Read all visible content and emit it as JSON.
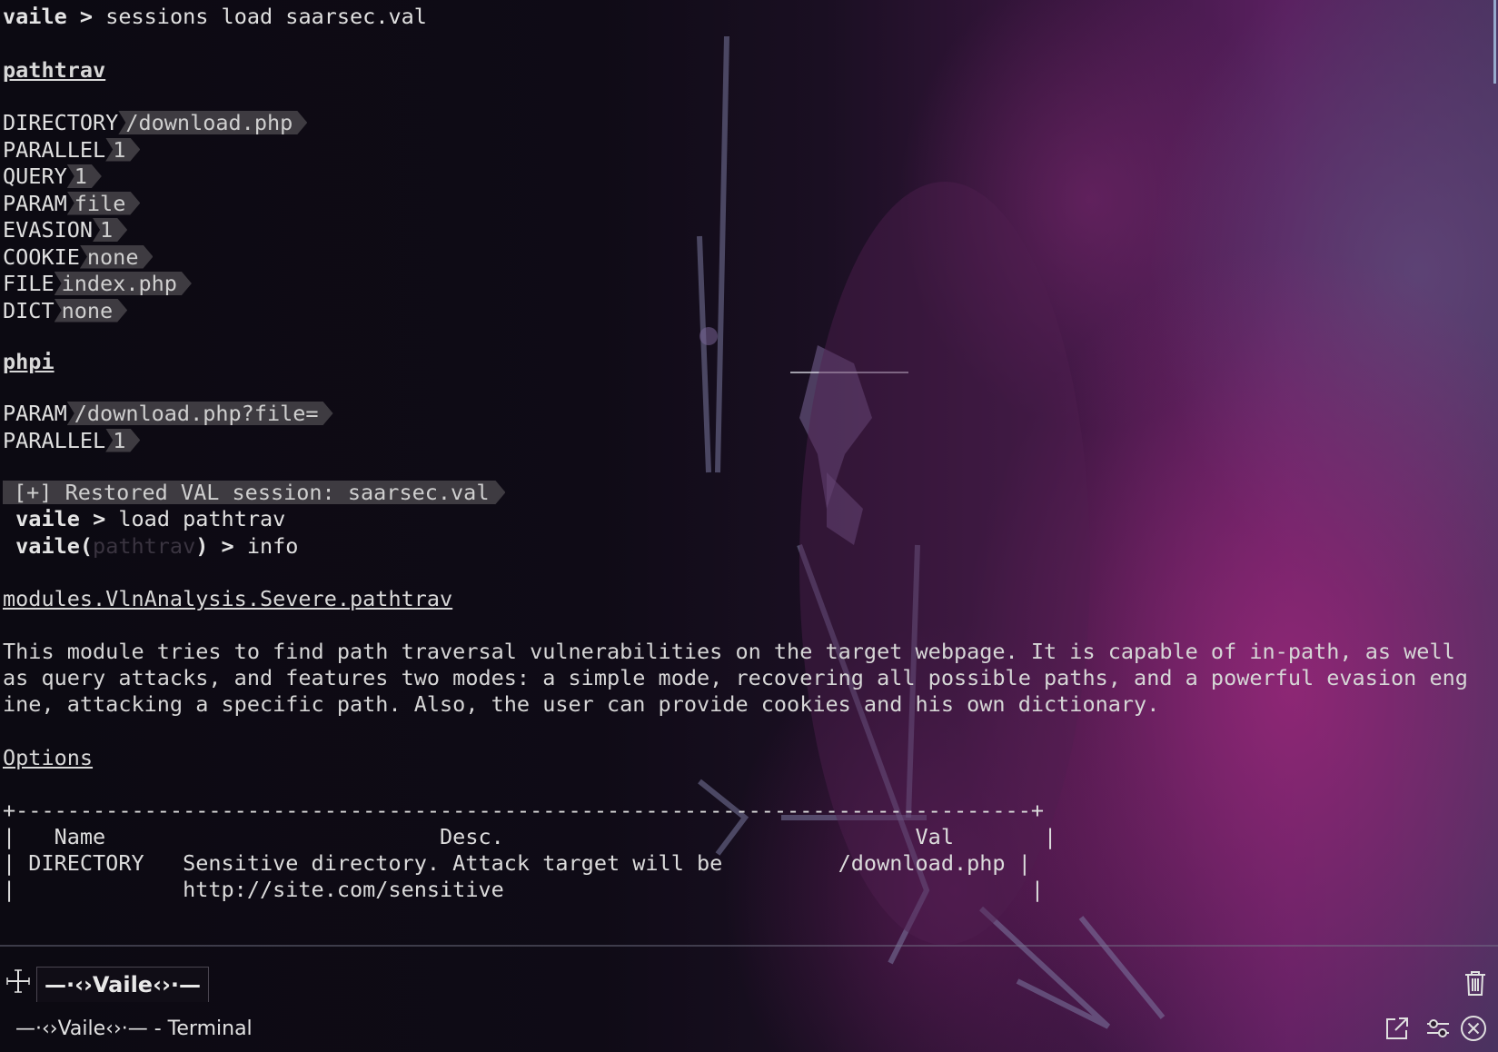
{
  "terminal": {
    "prompt": "vaile",
    "prompt_sep": " > ",
    "cmd1": "sessions load saarsec.val",
    "section1": "pathtrav",
    "pathtrav_options": [
      {
        "key": "DIRECTORY",
        "val": "/download.php"
      },
      {
        "key": "PARALLEL",
        "val": "1"
      },
      {
        "key": "QUERY",
        "val": "1"
      },
      {
        "key": "PARAM",
        "val": "file"
      },
      {
        "key": "EVASION",
        "val": "1"
      },
      {
        "key": "COOKIE",
        "val": "none"
      },
      {
        "key": "FILE",
        "val": "index.php"
      },
      {
        "key": "DICT",
        "val": "none"
      }
    ],
    "section2": "phpi",
    "phpi_options": [
      {
        "key": "PARAM",
        "val": "/download.php?file="
      },
      {
        "key": "PARALLEL",
        "val": "1"
      }
    ],
    "restored_msg": "[+] Restored VAL session: saarsec.val",
    "cmd2": "load pathtrav",
    "prompt_mod_open": "vaile(",
    "prompt_mod_name": "pathtrav",
    "prompt_mod_close": ")",
    "cmd3": "info",
    "module_path": "modules.VlnAnalysis.Severe.pathtrav",
    "description_lines": [
      "This module tries to find path traversal vulnerabilities on the target webpage. It is capable of in-path, as well",
      "as query attacks, and features two modes: a simple mode, recovering all possible paths, and a powerful evasion eng",
      "ine, attacking a specific path. Also, the user can provide cookies and his own dictionary."
    ],
    "options_heading": "Options",
    "table_lines": [
      "+-------------------------------------------------------------------------------+",
      "|   Name                          Desc.                                Val       |",
      "| DIRECTORY   Sensitive directory. Attack target will be         /download.php |",
      "|             http://site.com/sensitive                                         |"
    ]
  },
  "tabbar": {
    "active_tab": "—·‹›Vaile‹›·—",
    "new_tab_icon": "plus-icon",
    "trash_icon": "trash-icon"
  },
  "statusbar": {
    "title": "—·‹›Vaile‹›·— - Terminal",
    "icons": [
      "open-external-icon",
      "sliders-icon",
      "close-circle-icon"
    ]
  },
  "colors": {
    "background": "#0c0a12",
    "text": "#dcdcdc",
    "value_chip": "#3e3b41",
    "accent_magenta": "#a0307a",
    "scrollbar": "#aac8e6"
  }
}
